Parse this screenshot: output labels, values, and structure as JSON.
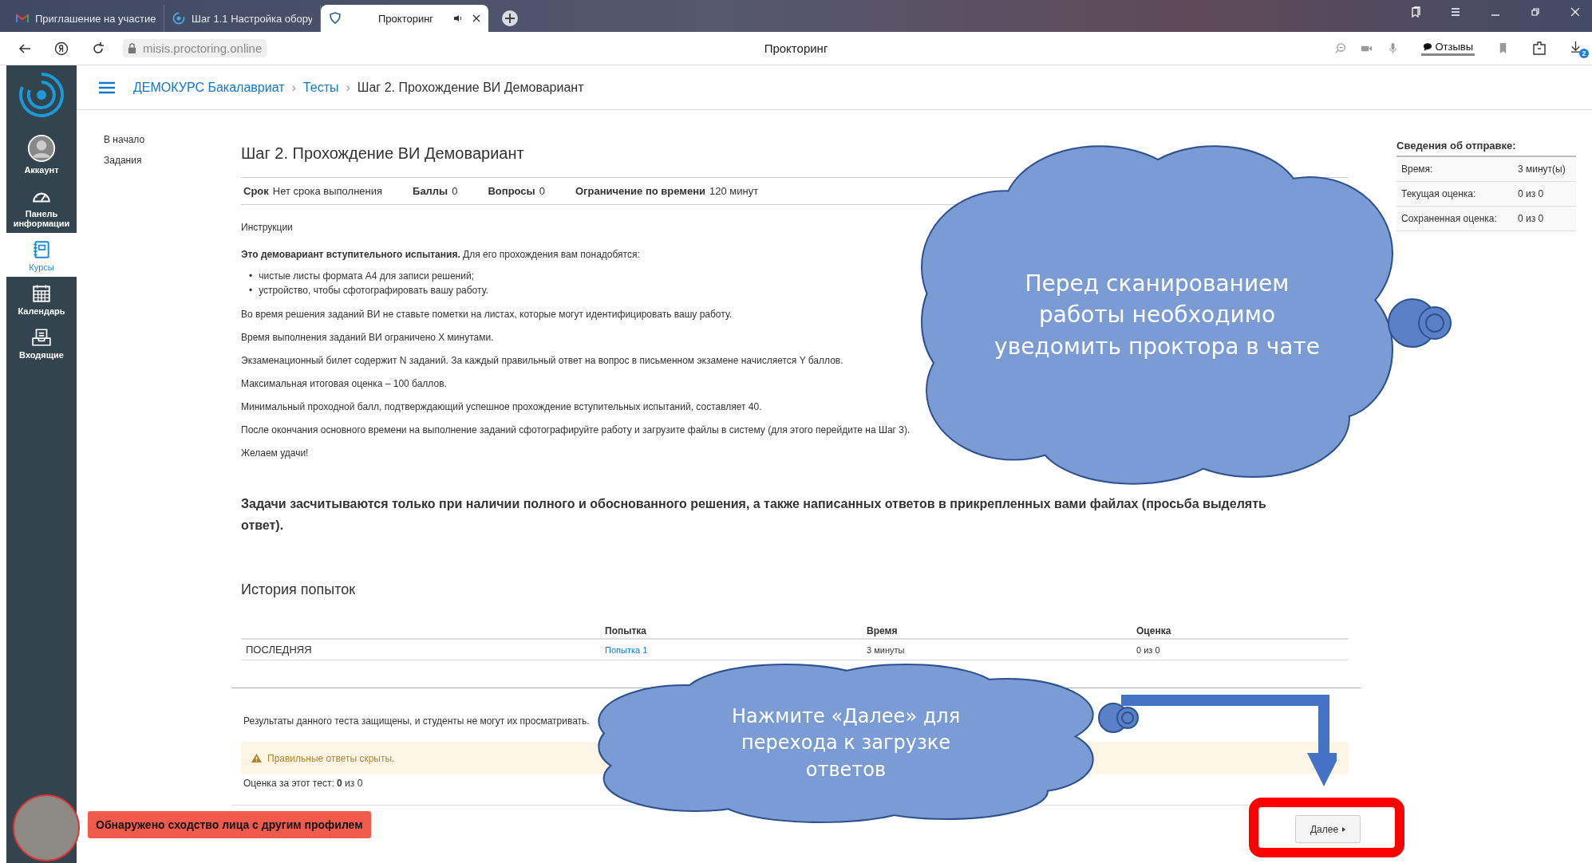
{
  "browser": {
    "tabs": [
      {
        "kind": "mail",
        "title": "Приглашение на участие",
        "selected": false
      },
      {
        "kind": "site",
        "title": "Шаг 1.1 Настройка обору",
        "selected": false
      },
      {
        "kind": "shield",
        "title": "Прокторинг",
        "selected": true,
        "sound": true
      }
    ],
    "address": "misis.proctoring.online",
    "page_title": "Прокторинг",
    "feedback": "Отзывы",
    "downloads_badge": "2"
  },
  "sidebar": {
    "items": [
      {
        "kind": "account",
        "label": "Аккаунт",
        "selected": false
      },
      {
        "kind": "dashboard",
        "label": "Панель информации",
        "selected": false
      },
      {
        "kind": "courses",
        "label": "Курсы",
        "selected": true
      },
      {
        "kind": "calendar",
        "label": "Календарь",
        "selected": false
      },
      {
        "kind": "inbox",
        "label": "Входящие",
        "selected": false
      }
    ]
  },
  "breadcrumb": {
    "separator": "›",
    "items": [
      {
        "label": "ДЕМОКУРС Бакалавриат",
        "link": true
      },
      {
        "label": "Тесты",
        "link": true
      },
      {
        "label": "Шаг 2. Прохождение ВИ Демовариант",
        "link": false
      }
    ]
  },
  "course_nav": [
    "В начало",
    "Задания"
  ],
  "quiz": {
    "title": "Шаг 2. Прохождение ВИ Демовариант",
    "details": [
      {
        "label": "Срок",
        "value": "Нет срока выполнения"
      },
      {
        "label": "Баллы",
        "value": "0"
      },
      {
        "label": "Вопросы",
        "value": "0"
      },
      {
        "label": "Ограничение по времени",
        "value": "120 минут"
      }
    ],
    "instructions_heading": "Инструкции",
    "intro": "**Это демовариант вступительного испытания.** Для его прохождения вам понадобятся:",
    "bullet_marker": "•",
    "bullets": [
      "чистые листы формата А4 для записи решений;",
      "устройство, чтобы сфотографировать вашу работу."
    ],
    "paragraphs": [
      "Во время решения заданий ВИ не ставьте пометки на листах, которые могут идентифицировать вашу работу.",
      "Время выполнения заданий ВИ ограничено X минутами.",
      "Экзаменационный билет содержит N заданий. За каждый правильный ответ на вопрос в письменном экзамене начисляется Y баллов.",
      "Максимальная итоговая оценка – 100 баллов.",
      "Минимальный проходной балл, подтверждающий успешное прохождение вступительных испытаний, составляет 40.",
      "После окончания основного времени на выполнение заданий сфотографируйте работу и загрузите файлы в систему (для этого перейдите на Шаг 3).",
      "Желаем удачи!"
    ],
    "notice": "Задачи засчитываются только при наличии полного и обоснованного решения, а также написанных ответов в прикрепленных вами файлах (просьба выделять ответ)."
  },
  "history": {
    "title": "История попыток",
    "columns": [
      "Попытка",
      "Время",
      "Оценка"
    ],
    "rows": [
      {
        "label": "ПОСЛЕДНЯЯ",
        "attempt": "Попытка 1",
        "time": "3 минуты",
        "grade": "0 из 0"
      }
    ]
  },
  "results": {
    "note": "Результаты данного теста защищены, и студенты не могут их просматривать.",
    "alert": "Правильные ответы скрыты.",
    "score": "Оценка за этот тест: **0** из 0"
  },
  "next_button": "Далее",
  "submission": {
    "title": "Сведения об отправке:",
    "rows": [
      {
        "label": "Время:",
        "value": "3 минут(ы)"
      },
      {
        "label": "Текущая оценка:",
        "value": "0 из 0"
      },
      {
        "label": "Сохраненная оценка:",
        "value": "0 из 0"
      }
    ]
  },
  "annotations": [
    "Перед сканированием работы необходимо уведомить проктора в чате",
    "Нажмите «Далее» для перехода к загрузке ответов"
  ],
  "proctor": {
    "warning": "Обнаружено сходство лица с другим профилем"
  }
}
